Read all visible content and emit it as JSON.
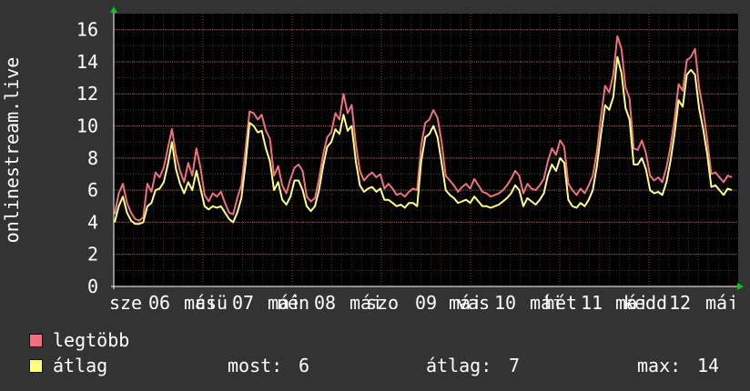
{
  "chart_data": {
    "type": "line",
    "ylabel": "onlinestream.live",
    "ylim": [
      0,
      17
    ],
    "yticks": [
      0,
      2,
      4,
      6,
      8,
      10,
      12,
      14,
      16
    ],
    "x_tick_labels": [
      "sze",
      "06",
      "máj",
      "csü",
      "07",
      "máj",
      "pén",
      "08",
      "máj",
      "szo",
      "09",
      "máj",
      "vas",
      "10",
      "máj",
      "hét",
      "11",
      "máj",
      "kedd",
      "12",
      "máj"
    ],
    "grid": true,
    "series": [
      {
        "name": "legtöbb",
        "color": "#f07080",
        "values": [
          4.5,
          5.8,
          6.4,
          5.2,
          4.6,
          4.2,
          4.1,
          4.3,
          6.4,
          5.9,
          7.1,
          6.8,
          7.4,
          8.6,
          9.8,
          8.2,
          7.2,
          6.5,
          7.7,
          6.9,
          8.6,
          7.4,
          5.7,
          5.3,
          5.8,
          5.6,
          5.9,
          5.2,
          4.6,
          4.5,
          5.5,
          6.3,
          8.5,
          10.9,
          10.8,
          10.4,
          10.7,
          9.7,
          9.2,
          6.9,
          7.5,
          6.3,
          5.8,
          6.7,
          7.4,
          7.6,
          7.2,
          5.6,
          5.3,
          5.5,
          6.7,
          8.2,
          9.3,
          9.6,
          10.8,
          10.4,
          12.0,
          10.8,
          11.3,
          8.9,
          7.2,
          6.6,
          6.9,
          7.1,
          6.8,
          7.0,
          6.1,
          6.4,
          6.1,
          5.7,
          5.8,
          5.6,
          5.9,
          6.1,
          6.0,
          8.8,
          10.2,
          10.4,
          11.0,
          10.5,
          9.0,
          6.9,
          6.6,
          6.3,
          5.9,
          6.2,
          6.4,
          6.1,
          6.7,
          6.3,
          5.9,
          5.8,
          5.6,
          5.7,
          5.8,
          6.0,
          6.3,
          6.7,
          7.2,
          6.9,
          5.8,
          6.4,
          6.1,
          6.0,
          6.3,
          6.7,
          7.8,
          8.6,
          8.2,
          9.1,
          8.7,
          6.4,
          6.0,
          5.7,
          6.1,
          5.8,
          6.3,
          6.9,
          8.4,
          10.6,
          12.5,
          12.1,
          13.2,
          15.6,
          14.8,
          12.4,
          11.7,
          8.6,
          8.5,
          9.1,
          8.3,
          6.9,
          6.6,
          6.8,
          6.5,
          7.4,
          8.7,
          10.4,
          12.6,
          12.2,
          14.1,
          14.3,
          14.8,
          12.4,
          11.0,
          9.1,
          7.0,
          7.1,
          6.8,
          6.5,
          6.9,
          6.8
        ]
      },
      {
        "name": "átlag",
        "color": "#ffff80",
        "values": [
          4.0,
          5.0,
          5.6,
          4.6,
          4.1,
          3.9,
          3.9,
          4.0,
          5.0,
          5.2,
          6.0,
          6.1,
          6.5,
          7.6,
          9.0,
          7.3,
          6.4,
          5.8,
          6.5,
          6.0,
          7.2,
          6.1,
          5.0,
          4.8,
          5.0,
          4.9,
          5.0,
          4.6,
          4.2,
          4.0,
          4.6,
          5.5,
          7.6,
          10.2,
          10.0,
          9.6,
          9.7,
          8.6,
          7.8,
          6.0,
          6.5,
          5.4,
          5.1,
          5.6,
          6.6,
          6.6,
          6.0,
          5.0,
          4.7,
          5.0,
          6.0,
          7.5,
          8.7,
          9.0,
          9.8,
          9.5,
          10.7,
          9.7,
          10.0,
          7.8,
          6.3,
          5.9,
          6.1,
          6.2,
          5.9,
          6.1,
          5.4,
          5.4,
          5.2,
          5.0,
          5.1,
          4.9,
          5.2,
          5.2,
          5.0,
          7.8,
          9.3,
          9.5,
          10.0,
          9.3,
          7.7,
          6.0,
          5.7,
          5.5,
          5.2,
          5.3,
          5.4,
          5.2,
          5.6,
          5.3,
          5.0,
          5.0,
          4.9,
          5.0,
          5.1,
          5.3,
          5.5,
          5.8,
          6.3,
          6.0,
          5.0,
          5.5,
          5.3,
          5.1,
          5.4,
          5.8,
          6.9,
          7.6,
          7.2,
          8.0,
          7.7,
          5.4,
          5.0,
          4.9,
          5.2,
          5.0,
          5.4,
          6.0,
          7.5,
          9.5,
          11.3,
          11.0,
          11.8,
          14.3,
          13.3,
          11.1,
          10.4,
          7.6,
          7.6,
          8.0,
          7.3,
          6.0,
          5.8,
          5.9,
          5.7,
          6.5,
          7.8,
          9.5,
          11.6,
          11.2,
          13.2,
          13.5,
          13.2,
          11.1,
          9.8,
          8.2,
          6.2,
          6.3,
          6.0,
          5.7,
          6.1,
          6.0
        ]
      }
    ],
    "stats": {
      "most_label": "most:",
      "most_value": "6",
      "avg_label": "átlag:",
      "avg_value": "7",
      "max_label": "max:",
      "max_value": "14"
    }
  }
}
